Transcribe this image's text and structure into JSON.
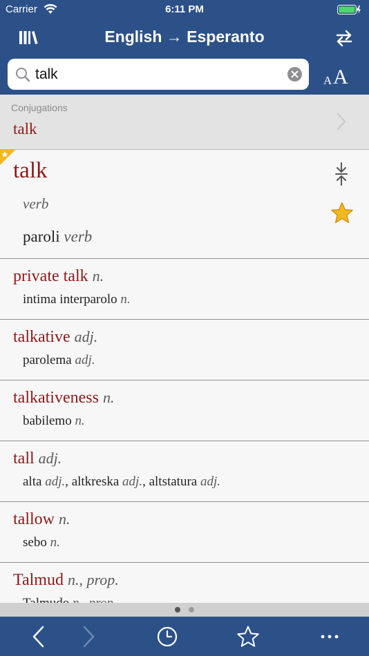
{
  "status": {
    "carrier": "Carrier",
    "time": "6:11 PM"
  },
  "nav": {
    "title_from": "English",
    "arrow": "→",
    "title_to": "Esperanto"
  },
  "search": {
    "value": "talk",
    "placeholder": ""
  },
  "font_button": {
    "small": "A",
    "big": "A"
  },
  "conjugations": {
    "label": "Conjugations",
    "word": "talk"
  },
  "main_entry": {
    "headword": "talk",
    "pos": "verb",
    "translation": "paroli",
    "translation_pos": "verb"
  },
  "entries": [
    {
      "head": "private talk",
      "head_pos": "n.",
      "translations": [
        {
          "word": "intima interparolo",
          "pos": "n."
        }
      ]
    },
    {
      "head": "talkative",
      "head_pos": "adj.",
      "translations": [
        {
          "word": "parolema",
          "pos": "adj."
        }
      ]
    },
    {
      "head": "talkativeness",
      "head_pos": "n.",
      "translations": [
        {
          "word": "babilemo",
          "pos": "n."
        }
      ]
    },
    {
      "head": "tall",
      "head_pos": "adj.",
      "translations": [
        {
          "word": "alta",
          "pos": "adj.",
          "sep": ", "
        },
        {
          "word": "altkreska",
          "pos": "adj.",
          "sep": ", "
        },
        {
          "word": "altstatura",
          "pos": "adj."
        }
      ]
    },
    {
      "head": "tallow",
      "head_pos": "n.",
      "translations": [
        {
          "word": "sebo",
          "pos": "n."
        }
      ]
    },
    {
      "head": "Talmud",
      "head_pos": "n., prop.",
      "translations": [
        {
          "word": "Talmudo",
          "pos": "n., prop."
        }
      ]
    }
  ],
  "page_dots": {
    "count": 2,
    "active": 0
  },
  "colors": {
    "bar": "#2c5189",
    "headword": "#8b1a1a",
    "star": "#f3b81d"
  },
  "icons": {
    "library": "library-icon",
    "swap": "swap-languages-icon",
    "search": "search-icon",
    "clear": "clear-icon",
    "back": "back-icon",
    "forward": "forward-icon",
    "history": "history-clock-icon",
    "favorites": "star-outline-icon",
    "more": "more-icon"
  }
}
